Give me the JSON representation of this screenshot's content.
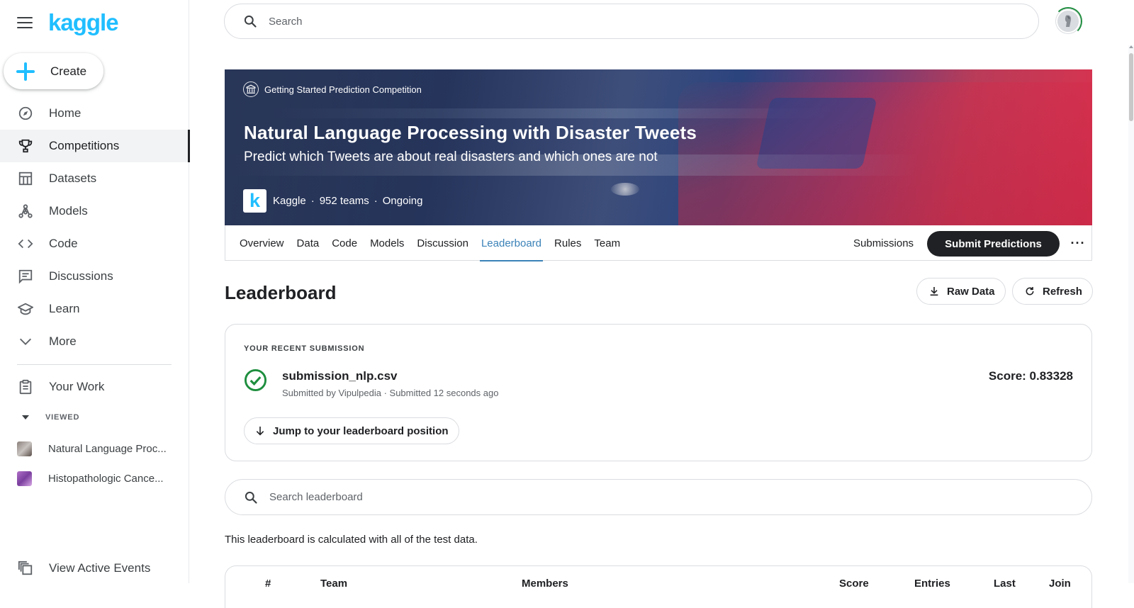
{
  "sidebar": {
    "logo": "kaggle",
    "create_label": "Create",
    "nav": [
      {
        "label": "Home",
        "icon": "compass-icon"
      },
      {
        "label": "Competitions",
        "icon": "trophy-icon",
        "active": true
      },
      {
        "label": "Datasets",
        "icon": "table-icon"
      },
      {
        "label": "Models",
        "icon": "models-icon"
      },
      {
        "label": "Code",
        "icon": "code-icon"
      },
      {
        "label": "Discussions",
        "icon": "comment-icon"
      },
      {
        "label": "Learn",
        "icon": "school-icon"
      },
      {
        "label": "More",
        "icon": "chevron-down-icon"
      }
    ],
    "your_work": "Your Work",
    "viewed_header": "VIEWED",
    "viewed": [
      {
        "label": "Natural Language Proc..."
      },
      {
        "label": "Histopathologic Cance..."
      }
    ],
    "events": "View Active Events"
  },
  "search": {
    "placeholder": "Search"
  },
  "banner": {
    "category": "Getting Started Prediction Competition",
    "title": "Natural Language Processing with Disaster Tweets",
    "subtitle": "Predict which Tweets are about real disasters and which ones are not",
    "host_logo": "k",
    "host": "Kaggle",
    "teams": "952 teams",
    "status": "Ongoing",
    "separator": "·"
  },
  "tabs": [
    "Overview",
    "Data",
    "Code",
    "Models",
    "Discussion",
    "Leaderboard",
    "Rules",
    "Team"
  ],
  "active_tab": "Leaderboard",
  "actions": {
    "submissions": "Submissions",
    "submit": "Submit Predictions",
    "more": "···"
  },
  "leaderboard": {
    "title": "Leaderboard",
    "raw_data": "Raw Data",
    "refresh": "Refresh",
    "recent": {
      "kicker": "YOUR RECENT SUBMISSION",
      "file": "submission_nlp.csv",
      "meta": "Submitted by Vipulpedia · Submitted 12 seconds ago",
      "score": "Score: 0.83328",
      "jump": "Jump to your leaderboard position"
    },
    "search_placeholder": "Search leaderboard",
    "note": "This leaderboard is calculated with all of the test data.",
    "columns": [
      "#",
      "Team",
      "Members",
      "Score",
      "Entries",
      "Last",
      "Join"
    ]
  },
  "colors": {
    "brand": "#20beff",
    "accent_tab": "#3b82b8",
    "success": "#1e8e3e",
    "dark_button": "#202124"
  }
}
